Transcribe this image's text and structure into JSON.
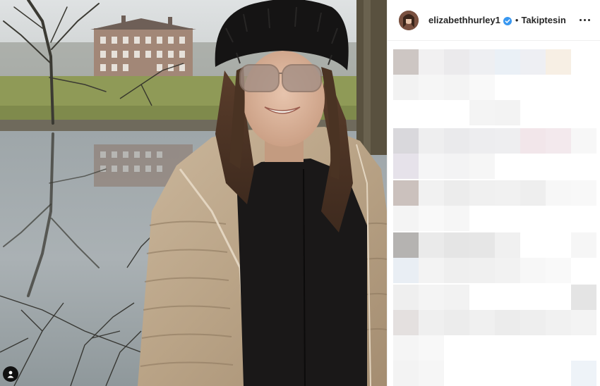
{
  "post": {
    "username": "elizabethhurley1",
    "separator": "•",
    "follow_label": "Takiptesin",
    "verified": true
  },
  "icons": {
    "verified": "verified-badge-icon",
    "more": "more-options-icon",
    "tag": "user-tag-icon"
  },
  "colors": {
    "text": "#262626",
    "verified_blue": "#3897f0",
    "divider": "#efefef"
  }
}
